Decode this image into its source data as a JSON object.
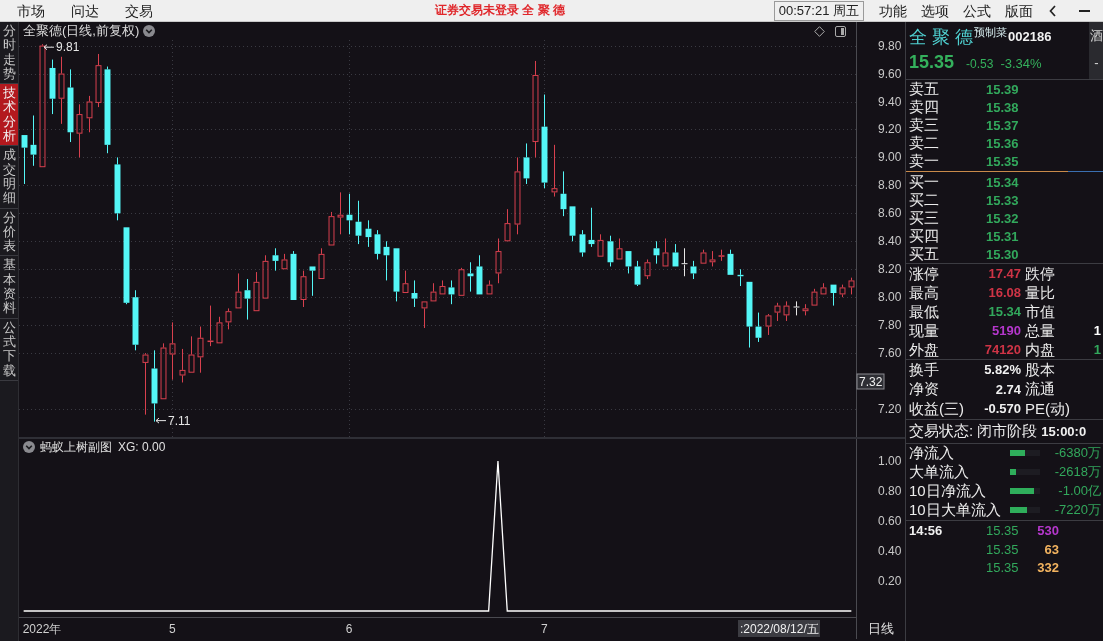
{
  "top_bar": {
    "menus": [
      {
        "label": "市场"
      },
      {
        "label": "问达"
      },
      {
        "label": "交易"
      }
    ],
    "notice": "证券交易未登录 全 聚 德",
    "clock": "00:57:21 周五",
    "actions": [
      {
        "label": "功能"
      },
      {
        "label": "选项"
      },
      {
        "label": "公式"
      },
      {
        "label": "版面"
      }
    ]
  },
  "side_tabs": [
    {
      "label": "分时走势",
      "selected": false
    },
    {
      "label": "技术分析",
      "selected": true
    },
    {
      "label": "成交明细",
      "selected": false
    },
    {
      "label": "分价表",
      "selected": false
    },
    {
      "label": "基本资料",
      "selected": false
    },
    {
      "label": "公式下载",
      "selected": false
    }
  ],
  "main_chart": {
    "title": "全聚德(日线,前复权)",
    "cursor_price": "7.32",
    "chart_data": [
      {
        "type": "candlestick",
        "grid": true,
        "ohlc": [
          [
            9.16,
            9.16,
            8.81,
            9.07
          ],
          [
            9.09,
            9.3,
            8.94,
            9.02
          ],
          [
            8.93,
            9.81,
            8.93,
            9.8
          ],
          [
            9.64,
            9.7,
            9.31,
            9.42
          ],
          [
            9.42,
            9.72,
            9.24,
            9.6
          ],
          [
            9.5,
            9.63,
            9.11,
            9.18
          ],
          [
            9.17,
            9.38,
            9.0,
            9.31
          ],
          [
            9.28,
            9.44,
            9.18,
            9.4
          ],
          [
            9.39,
            9.74,
            9.36,
            9.66
          ],
          [
            9.63,
            9.65,
            9.03,
            9.09
          ],
          [
            8.95,
            9.0,
            8.55,
            8.6
          ],
          [
            8.5,
            8.5,
            7.95,
            7.96
          ],
          [
            8.0,
            8.05,
            7.62,
            7.66
          ],
          [
            7.53,
            7.6,
            7.16,
            7.59
          ],
          [
            7.49,
            7.62,
            7.11,
            7.24
          ],
          [
            7.27,
            7.67,
            7.27,
            7.64
          ],
          [
            7.59,
            7.82,
            7.41,
            7.67
          ],
          [
            7.44,
            7.63,
            7.39,
            7.48
          ],
          [
            7.46,
            7.72,
            7.46,
            7.59
          ],
          [
            7.57,
            7.79,
            7.46,
            7.71
          ],
          [
            7.68,
            7.94,
            7.65,
            7.69
          ],
          [
            7.67,
            7.86,
            7.67,
            7.82
          ],
          [
            7.82,
            7.92,
            7.77,
            7.9
          ],
          [
            7.92,
            8.17,
            7.92,
            8.04
          ],
          [
            8.05,
            8.13,
            7.84,
            7.99
          ],
          [
            7.9,
            8.18,
            7.9,
            8.11
          ],
          [
            7.99,
            8.3,
            7.99,
            8.26
          ],
          [
            8.3,
            8.35,
            8.19,
            8.26
          ],
          [
            8.2,
            8.31,
            8.2,
            8.27
          ],
          [
            8.31,
            8.33,
            7.98,
            7.98
          ],
          [
            7.98,
            8.19,
            7.93,
            8.15
          ],
          [
            8.22,
            8.22,
            8.01,
            8.19
          ],
          [
            8.13,
            8.35,
            8.13,
            8.31
          ],
          [
            8.37,
            8.61,
            8.37,
            8.58
          ],
          [
            8.57,
            8.75,
            8.45,
            8.59
          ],
          [
            8.59,
            8.74,
            8.45,
            8.55
          ],
          [
            8.54,
            8.69,
            8.38,
            8.44
          ],
          [
            8.49,
            8.55,
            8.36,
            8.43
          ],
          [
            8.45,
            8.48,
            8.27,
            8.31
          ],
          [
            8.36,
            8.4,
            8.12,
            8.3
          ],
          [
            8.35,
            8.35,
            7.97,
            8.04
          ],
          [
            8.03,
            8.19,
            8.03,
            8.1
          ],
          [
            8.03,
            8.12,
            7.93,
            7.99
          ],
          [
            7.92,
            7.97,
            7.78,
            7.97
          ],
          [
            7.97,
            8.1,
            7.97,
            8.04
          ],
          [
            8.02,
            8.12,
            8.02,
            8.08
          ],
          [
            8.07,
            8.12,
            7.95,
            8.02
          ],
          [
            8.01,
            8.21,
            8.01,
            8.2
          ],
          [
            8.17,
            8.25,
            8.04,
            8.15
          ],
          [
            8.22,
            8.3,
            8.02,
            8.02
          ],
          [
            8.02,
            8.12,
            8.02,
            8.09
          ],
          [
            8.17,
            8.42,
            8.1,
            8.33
          ],
          [
            8.4,
            8.63,
            8.4,
            8.53
          ],
          [
            8.52,
            9.0,
            8.45,
            8.9
          ],
          [
            9.0,
            9.1,
            8.81,
            8.85
          ],
          [
            9.11,
            9.69,
            9.0,
            9.59
          ],
          [
            9.22,
            9.45,
            8.78,
            8.82
          ],
          [
            8.75,
            9.09,
            8.72,
            8.78
          ],
          [
            8.74,
            8.9,
            8.58,
            8.63
          ],
          [
            8.65,
            8.65,
            8.4,
            8.44
          ],
          [
            8.45,
            8.48,
            8.29,
            8.32
          ],
          [
            8.41,
            8.64,
            8.36,
            8.38
          ],
          [
            8.29,
            8.45,
            8.29,
            8.41
          ],
          [
            8.4,
            8.44,
            8.22,
            8.25
          ],
          [
            8.27,
            8.42,
            8.27,
            8.35
          ],
          [
            8.33,
            8.33,
            8.17,
            8.22
          ],
          [
            8.22,
            8.26,
            8.08,
            8.09
          ],
          [
            8.15,
            8.27,
            8.13,
            8.25
          ],
          [
            8.35,
            8.4,
            8.24,
            8.3
          ],
          [
            8.22,
            8.42,
            8.22,
            8.32
          ],
          [
            8.32,
            8.38,
            8.22,
            8.22
          ],
          [
            8.24,
            8.35,
            8.15,
            8.24
          ],
          [
            8.22,
            8.26,
            8.13,
            8.17
          ],
          [
            8.24,
            8.34,
            8.24,
            8.32
          ],
          [
            8.25,
            8.33,
            8.22,
            8.27
          ],
          [
            8.29,
            8.34,
            8.26,
            8.3
          ],
          [
            8.31,
            8.34,
            8.16,
            8.16
          ],
          [
            8.16,
            8.2,
            8.08,
            8.15
          ],
          [
            8.11,
            8.11,
            7.64,
            7.79
          ],
          [
            7.79,
            7.89,
            7.68,
            7.71
          ],
          [
            7.79,
            7.88,
            7.73,
            7.87
          ],
          [
            7.89,
            7.96,
            7.83,
            7.94
          ],
          [
            7.87,
            7.97,
            7.83,
            7.94
          ],
          [
            7.93,
            7.97,
            7.87,
            7.93
          ],
          [
            7.9,
            7.95,
            7.87,
            7.92
          ],
          [
            7.94,
            8.06,
            7.94,
            8.04
          ],
          [
            8.02,
            8.1,
            8.02,
            8.07
          ],
          [
            8.09,
            8.09,
            7.94,
            8.03
          ],
          [
            8.02,
            8.09,
            8.0,
            8.07
          ],
          [
            8.07,
            8.14,
            8.02,
            8.12
          ]
        ],
        "ylim": [
          7.0,
          9.84
        ],
        "yticks": [
          {
            "value": 9.8,
            "label": "9.80"
          },
          {
            "value": 9.6,
            "label": "9.60"
          },
          {
            "value": 9.4,
            "label": "9.40"
          },
          {
            "value": 9.2,
            "label": "9.20"
          },
          {
            "value": 9.0,
            "label": "9.00"
          },
          {
            "value": 8.8,
            "label": "8.80"
          },
          {
            "value": 8.6,
            "label": "8.60"
          },
          {
            "value": 8.4,
            "label": "8.40"
          },
          {
            "value": 8.2,
            "label": "8.20"
          },
          {
            "value": 8.0,
            "label": "8.00"
          },
          {
            "value": 7.8,
            "label": "7.80"
          },
          {
            "value": 7.6,
            "label": "7.60"
          },
          {
            "value": 7.2,
            "label": "7.20"
          }
        ],
        "annotations": [
          "9.81",
          "7.11"
        ]
      }
    ]
  },
  "sub_chart": {
    "indicator": "蚂蚁上树副图",
    "readout": "XG: 0.00",
    "axis_start_label": "2022年",
    "cursor_date": ":2022/08/12/五",
    "period": "日线",
    "chart_data": [
      {
        "type": "line",
        "color": "#ffffff",
        "categories": [
          null,
          null,
          null,
          null,
          null,
          null,
          null,
          null,
          null,
          null,
          null,
          null,
          null,
          null,
          null,
          null,
          "5",
          null,
          null,
          null,
          null,
          null,
          null,
          null,
          null,
          null,
          null,
          null,
          null,
          null,
          null,
          null,
          null,
          null,
          null,
          "6",
          null,
          null,
          null,
          null,
          null,
          null,
          null,
          null,
          null,
          null,
          null,
          null,
          null,
          null,
          null,
          null,
          null,
          null,
          null,
          null,
          "7",
          null,
          null,
          null,
          null,
          null,
          null,
          null,
          null,
          null,
          null,
          null,
          null,
          null,
          null,
          null,
          null,
          null,
          null,
          null,
          null,
          null,
          null,
          null,
          null,
          null,
          null,
          null,
          null,
          null,
          null,
          null,
          null,
          null
        ],
        "values": [
          0,
          0,
          0,
          0,
          0,
          0,
          0,
          0,
          0,
          0,
          0,
          0,
          0,
          0,
          0,
          0,
          0,
          0,
          0,
          0,
          0,
          0,
          0,
          0,
          0,
          0,
          0,
          0,
          0,
          0,
          0,
          0,
          0,
          0,
          0,
          0,
          0,
          0,
          0,
          0,
          0,
          0,
          0,
          0,
          0,
          0,
          0,
          0,
          0,
          0,
          0,
          1,
          0,
          0,
          0,
          0,
          0,
          0,
          0,
          0,
          0,
          0,
          0,
          0,
          0,
          0,
          0,
          0,
          0,
          0,
          0,
          0,
          0,
          0,
          0,
          0,
          0,
          0,
          0,
          0,
          0,
          0,
          0,
          0,
          0,
          0,
          0,
          0,
          0,
          0
        ],
        "ylim": [
          -0.04,
          1.04
        ],
        "yticks": [
          {
            "value": 0.2,
            "label": "0.20"
          },
          {
            "value": 0.4,
            "label": "0.40"
          },
          {
            "value": 0.6,
            "label": "0.60"
          },
          {
            "value": 0.8,
            "label": "0.80"
          },
          {
            "value": 1.0,
            "label": "1.00"
          }
        ]
      }
    ]
  },
  "quote_panel": {
    "name": "全 聚 德",
    "tag": "预制菜",
    "code": "002186",
    "side_column": [
      "酒",
      "-"
    ],
    "price": "15.35",
    "change": "-0.53",
    "change_pct": "-3.34%",
    "asks": [
      {
        "label": "卖五",
        "price": "15.39"
      },
      {
        "label": "卖四",
        "price": "15.38"
      },
      {
        "label": "卖三",
        "price": "15.37"
      },
      {
        "label": "卖二",
        "price": "15.36"
      },
      {
        "label": "卖一",
        "price": "15.35"
      }
    ],
    "bids": [
      {
        "label": "买一",
        "price": "15.34"
      },
      {
        "label": "买二",
        "price": "15.33"
      },
      {
        "label": "买三",
        "price": "15.32"
      },
      {
        "label": "买四",
        "price": "15.31"
      },
      {
        "label": "买五",
        "price": "15.30"
      }
    ],
    "stats": [
      {
        "cells": [
          {
            "label": "涨停",
            "value": "17.47",
            "color": "#cf3446"
          },
          {
            "label": "跌停"
          }
        ]
      },
      {
        "cells": [
          {
            "label": "最高",
            "value": "16.08",
            "color": "#cf3446"
          },
          {
            "label": "量比"
          }
        ]
      },
      {
        "cells": [
          {
            "label": "最低",
            "value": "15.34",
            "color": "#32a85c"
          },
          {
            "label": "市值"
          }
        ]
      },
      {
        "cells": [
          {
            "label": "现量",
            "value": "5190",
            "color": "#b537cc"
          },
          {
            "label": "总量",
            "value": "1",
            "color": "#ffffff"
          }
        ]
      },
      {
        "cells": [
          {
            "label": "外盘",
            "value": "74120",
            "color": "#cf3446"
          },
          {
            "label": "内盘",
            "value": "1",
            "color": "#32a85c"
          }
        ]
      }
    ],
    "fundamentals": [
      {
        "label": "换手",
        "value": "5.82%",
        "label2": "股本"
      },
      {
        "label": "净资",
        "value": "2.74",
        "label2": "流通"
      },
      {
        "label": "收益(三)",
        "value": "-0.570",
        "label2": "PE(动)"
      }
    ],
    "status": {
      "text": "交易状态: 闭市阶段",
      "time": "15:00:0"
    },
    "fund_flow": [
      {
        "label": "净流入",
        "level": 0.51,
        "value": "-6380万"
      },
      {
        "label": "大单流入",
        "level": 0.21,
        "value": "-2618万"
      },
      {
        "label": "10日净流入",
        "level": 0.8,
        "value": "-1.00亿"
      },
      {
        "label": "10日大单流入",
        "level": 0.58,
        "value": "-7220万"
      }
    ],
    "ticks": [
      {
        "time": "14:56",
        "price": "15.35",
        "volume": "530",
        "color": "#b537cc"
      },
      {
        "price": "15.35",
        "volume": "63",
        "color": "#f2b35f"
      },
      {
        "price": "15.35",
        "volume": "332",
        "color": "#f2b35f"
      }
    ]
  }
}
